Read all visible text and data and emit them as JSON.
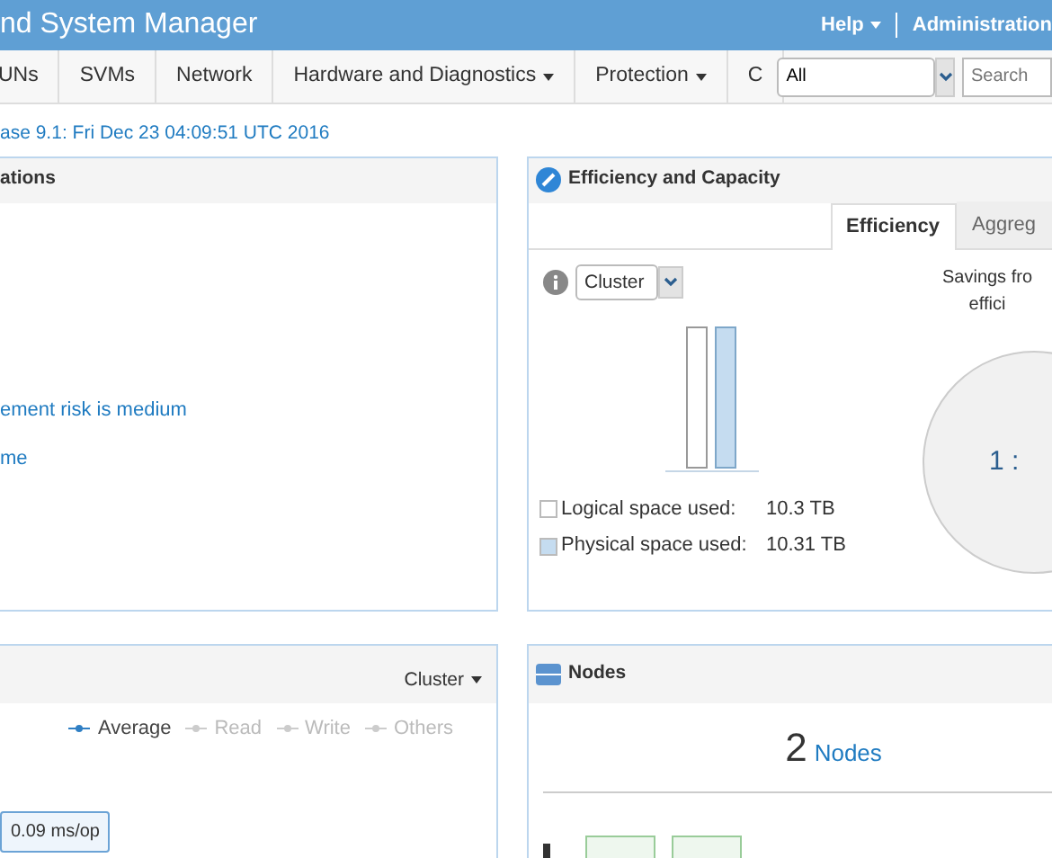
{
  "header": {
    "title": "nd System Manager",
    "menus": [
      {
        "label": "Help",
        "dropdown": true
      },
      {
        "label": "Administration",
        "dropdown": false
      }
    ]
  },
  "nav": {
    "items": [
      {
        "label": "UNs",
        "dropdown": false
      },
      {
        "label": "SVMs",
        "dropdown": false
      },
      {
        "label": "Network",
        "dropdown": false
      },
      {
        "label": "Hardware and Diagnostics",
        "dropdown": true
      },
      {
        "label": "Protection",
        "dropdown": true
      },
      {
        "label": "C",
        "dropdown": false
      }
    ],
    "scope": {
      "value": "All"
    },
    "search": {
      "placeholder": "Search"
    }
  },
  "version": "ase 9.1: Fri Dec 23 04:09:51 UTC 2016",
  "notifications": {
    "title": "ations",
    "links": [
      "ement risk is medium",
      "me"
    ]
  },
  "efficiency": {
    "title": "Efficiency and Capacity",
    "tabs": [
      {
        "label": "Efficiency",
        "selected": true
      },
      {
        "label": "Aggreg",
        "selected": false
      }
    ],
    "scope": "Cluster",
    "legend": [
      {
        "label": "Logical space used:",
        "value": "10.3 TB",
        "kind": "logical"
      },
      {
        "label": "Physical space used:",
        "value": "10.31 TB",
        "kind": "physical"
      }
    ],
    "savings": [
      "Savings fro",
      "effici"
    ],
    "ratio": "1 :"
  },
  "performance": {
    "scope": "Cluster",
    "legend": [
      {
        "label": "Average",
        "active": true
      },
      {
        "label": "Read",
        "active": false
      },
      {
        "label": "Write",
        "active": false
      },
      {
        "label": "Others",
        "active": false
      }
    ],
    "tooltip": "0.09 ms/op"
  },
  "nodes": {
    "title": "Nodes",
    "count": "2",
    "link": "Nodes"
  }
}
